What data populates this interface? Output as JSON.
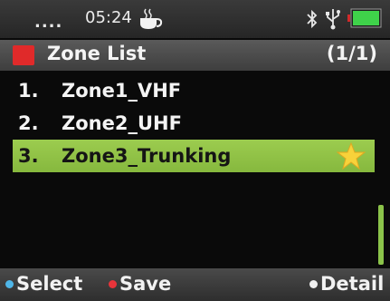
{
  "status_bar": {
    "dots": "....",
    "time": "05:24",
    "icons": [
      "coffee-cup-icon",
      "bluetooth-icon",
      "usb-icon",
      "battery-icon"
    ]
  },
  "header": {
    "title": "Zone List",
    "page_indicator": "(1/1)",
    "accent_color": "#e02a2a"
  },
  "list": {
    "items": [
      {
        "number": "1.",
        "label": "Zone1_VHF",
        "selected": false
      },
      {
        "number": "2.",
        "label": "Zone2_UHF",
        "selected": false
      },
      {
        "number": "3.",
        "label": "Zone3_Trunking",
        "selected": true,
        "icon": "star-icon"
      }
    ],
    "selection_color": "#8bc34a"
  },
  "softkeys": {
    "left": "Select",
    "middle": "Save",
    "right": "Detail"
  }
}
